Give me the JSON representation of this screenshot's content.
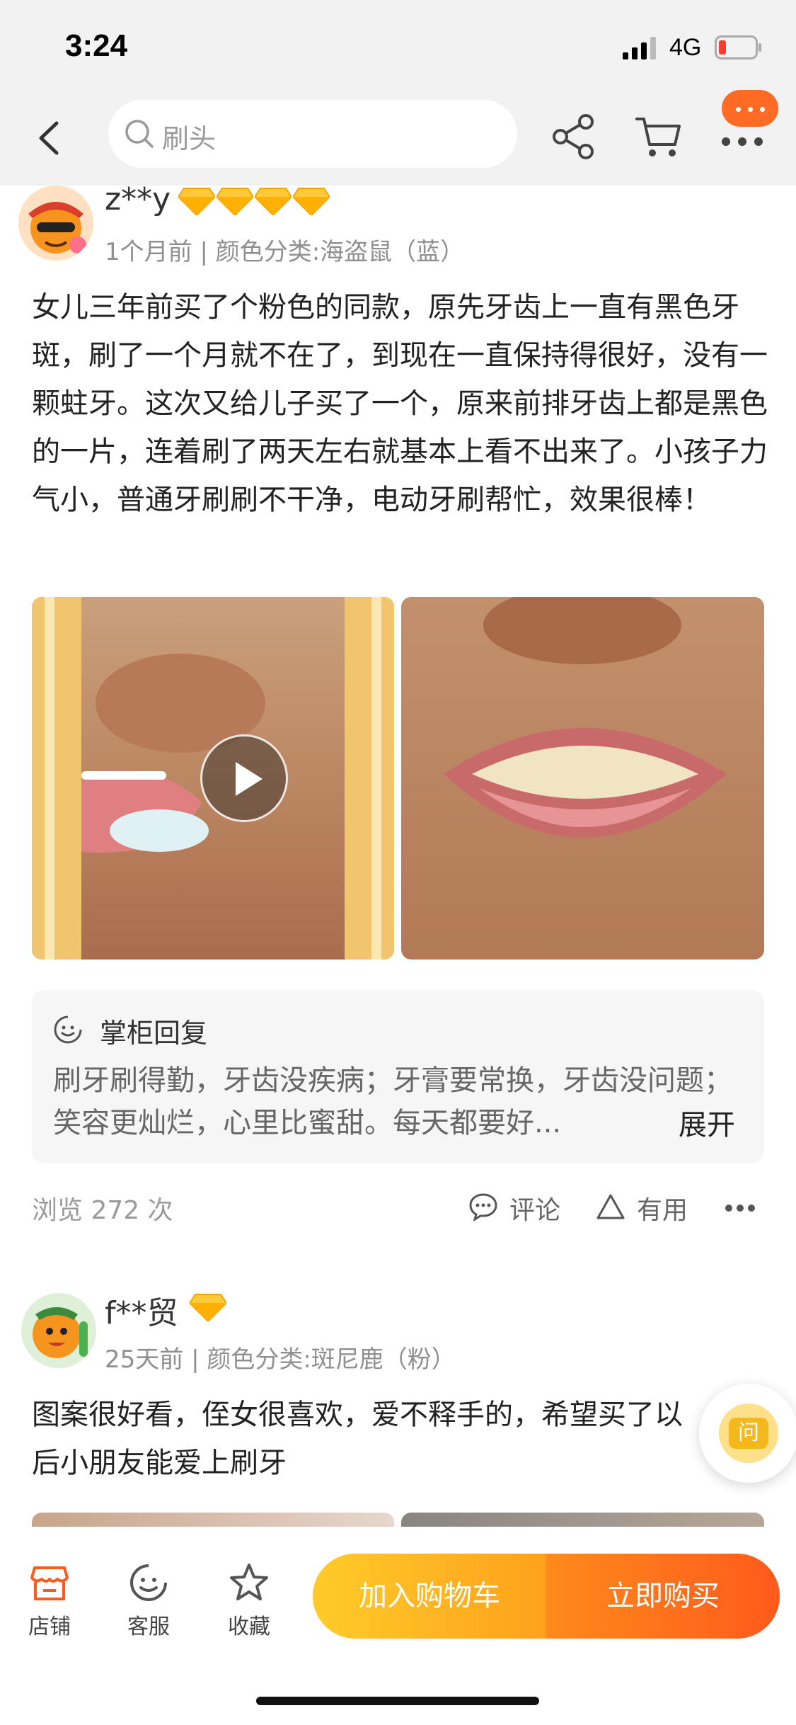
{
  "status_bar": {
    "time": "3:24",
    "network": "4G"
  },
  "nav": {
    "search_placeholder": "刷头"
  },
  "reviews": [
    {
      "username": "z**y",
      "diamonds": 4,
      "meta": "1个月前 | 颜色分类:海盗鼠（蓝）",
      "text": "女儿三年前买了个粉色的同款，原先牙齿上一直有黑色牙斑，刷了一个月就不在了，到现在一直保持得很好，没有一颗蛀牙。这次又给儿子买了一个，原来前排牙齿上都是黑色的一片，连着刷了两天左右就基本上看不出来了。小孩子力气小，普通牙刷刷不干净，电动牙刷帮忙，效果很棒！",
      "reply": {
        "title": "掌柜回复",
        "text": "刷牙刷得勤，牙齿没疾病；牙膏要常换，牙齿没问题；笑容更灿烂，心里比蜜甜。每天都要好...",
        "expand": "展开"
      },
      "views": "浏览 272 次",
      "actions": {
        "comment": "评论",
        "useful": "有用"
      }
    },
    {
      "username": "f**贸",
      "diamonds": 1,
      "meta": "25天前 | 颜色分类:斑尼鹿（粉）",
      "text": "图案很好看，侄女很喜欢，爱不释手的，希望买了以后小朋友能爱上刷牙"
    }
  ],
  "ask_button": "问",
  "bottom_bar": {
    "store": "店铺",
    "service": "客服",
    "favorite": "收藏",
    "add_to_cart": "加入购物车",
    "buy_now": "立即购买"
  },
  "colors": {
    "accent": "#ff6a25",
    "cart_gradient": "#ffb21f",
    "buy_gradient": "#ff6a1c",
    "diamond": "#ffc93a"
  }
}
